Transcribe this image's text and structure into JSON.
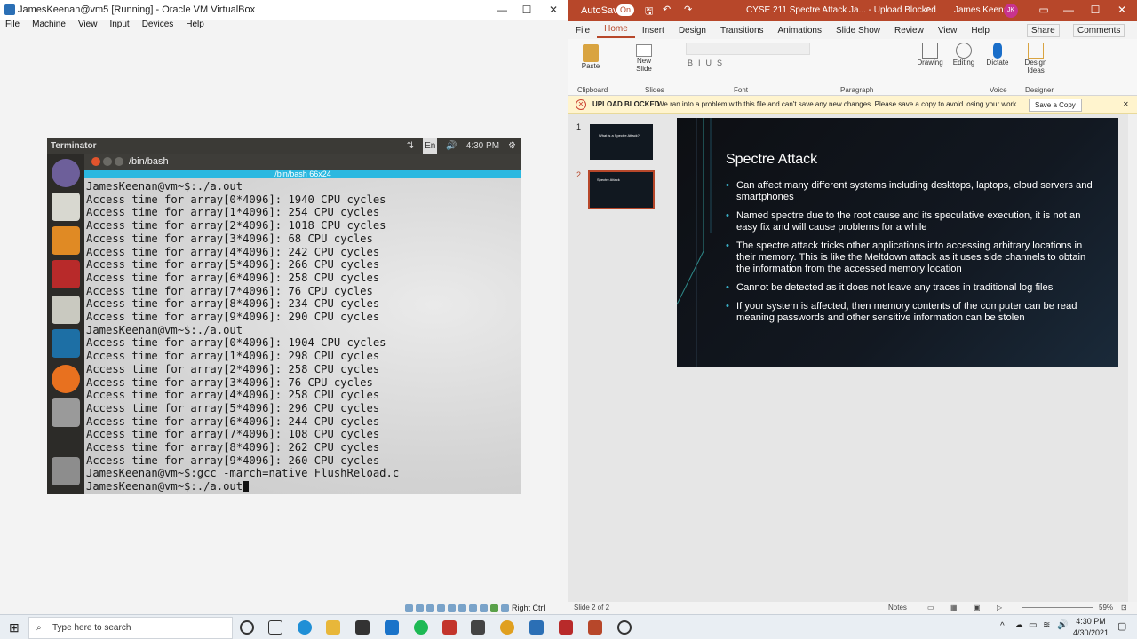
{
  "vbox": {
    "title": "JamesKeenan@vm5 [Running] - Oracle VM VirtualBox",
    "menu": [
      "File",
      "Machine",
      "View",
      "Input",
      "Devices",
      "Help"
    ],
    "host_key": "Right Ctrl"
  },
  "terminator": {
    "app_title": "Terminator",
    "clock": "4:30 PM",
    "lang": "En",
    "window_title": "/bin/bash",
    "tab_title": "/bin/bash 66x24",
    "lines": [
      "JamesKeenan@vm~$:./a.out",
      "Access time for array[0*4096]: 1940 CPU cycles",
      "Access time for array[1*4096]: 254 CPU cycles",
      "Access time for array[2*4096]: 1018 CPU cycles",
      "Access time for array[3*4096]: 68 CPU cycles",
      "Access time for array[4*4096]: 242 CPU cycles",
      "Access time for array[5*4096]: 266 CPU cycles",
      "Access time for array[6*4096]: 258 CPU cycles",
      "Access time for array[7*4096]: 76 CPU cycles",
      "Access time for array[8*4096]: 234 CPU cycles",
      "Access time for array[9*4096]: 290 CPU cycles",
      "JamesKeenan@vm~$:./a.out",
      "Access time for array[0*4096]: 1904 CPU cycles",
      "Access time for array[1*4096]: 298 CPU cycles",
      "Access time for array[2*4096]: 258 CPU cycles",
      "Access time for array[3*4096]: 76 CPU cycles",
      "Access time for array[4*4096]: 258 CPU cycles",
      "Access time for array[5*4096]: 296 CPU cycles",
      "Access time for array[6*4096]: 244 CPU cycles",
      "Access time for array[7*4096]: 108 CPU cycles",
      "Access time for array[8*4096]: 262 CPU cycles",
      "Access time for array[9*4096]: 260 CPU cycles",
      "JamesKeenan@vm~$:gcc -march=native FlushReload.c",
      "JamesKeenan@vm~$:./a.out"
    ]
  },
  "ppt": {
    "autosave_label": "AutoSave",
    "autosave_state": "On",
    "doc_title": "CYSE 211 Spectre Attack Ja... - Upload Blocked",
    "user_name": "James Keenan",
    "user_initials": "JK",
    "tabs": [
      "File",
      "Home",
      "Insert",
      "Design",
      "Transitions",
      "Animations",
      "Slide Show",
      "Review",
      "View",
      "Help"
    ],
    "active_tab": "Home",
    "share_label": "Share",
    "comments_label": "Comments",
    "groups": {
      "clipboard": "Clipboard",
      "slides": "Slides",
      "font": "Font",
      "paragraph": "Paragraph",
      "voice": "Voice",
      "designer": "Designer"
    },
    "buttons": {
      "paste": "Paste",
      "new_slide_1": "New",
      "new_slide_2": "Slide",
      "drawing": "Drawing",
      "editing": "Editing",
      "dictate": "Dictate",
      "design_ideas_1": "Design",
      "design_ideas_2": "Ideas"
    },
    "message": {
      "label": "UPLOAD BLOCKED",
      "text": "We ran into a problem with this file and can't save any new changes. Please save a copy to avoid losing your work.",
      "button": "Save a Copy"
    },
    "thumbs": [
      {
        "num": "1",
        "title": "What is a Spectre Attack?"
      },
      {
        "num": "2",
        "title": "Spectre Attack"
      }
    ],
    "slide": {
      "title": "Spectre Attack",
      "bullets": [
        "Can affect many different systems including desktops, laptops, cloud servers and smartphones",
        "Named spectre due to the root cause and its speculative execution, it is not an easy fix and will cause problems for a while",
        "The spectre attack tricks other applications into accessing arbitrary locations in their memory. This is like the Meltdown attack as it uses side channels to obtain the information from the accessed memory location",
        "Cannot be detected as it does not leave any traces in traditional log files",
        "If your system is affected, then memory contents of the computer can be read meaning passwords and other sensitive information can be stolen"
      ]
    },
    "status": {
      "slide_of": "Slide 2 of 2",
      "notes": "Notes",
      "zoom": "59%"
    }
  },
  "taskbar": {
    "search_placeholder": "Type here to search",
    "time": "4:30 PM",
    "date": "4/30/2021"
  },
  "colors": {
    "ppt_accent": "#b7472a",
    "terminal_tab": "#2bb8e0",
    "slide_bg": "#0d0f13"
  }
}
